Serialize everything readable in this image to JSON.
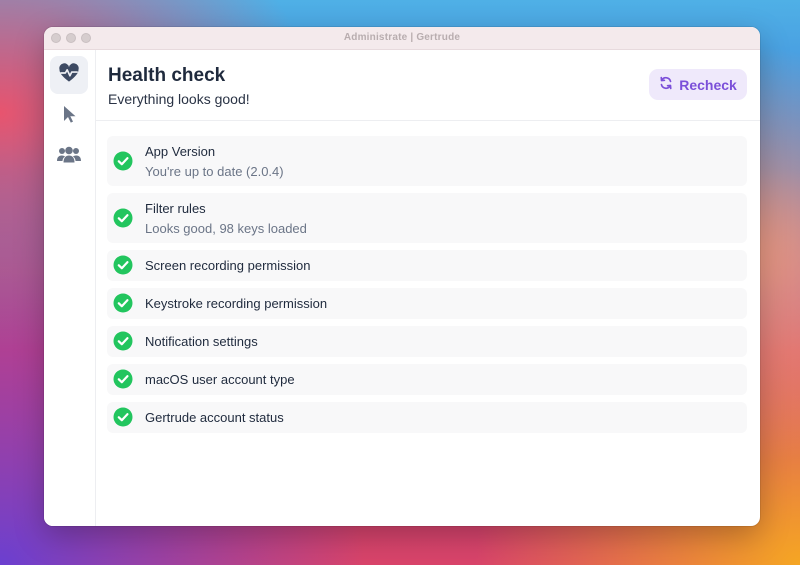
{
  "window": {
    "title": "Administrate  |  Gertrude"
  },
  "sidebar": {
    "items": [
      {
        "name": "health-check",
        "icon": "heart-pulse-icon",
        "active": true
      },
      {
        "name": "actions",
        "icon": "cursor-arrow-icon",
        "active": false
      },
      {
        "name": "users",
        "icon": "users-group-icon",
        "active": false
      }
    ]
  },
  "header": {
    "title": "Health check",
    "subtitle": "Everything looks good!",
    "recheck_label": "Recheck",
    "recheck_icon": "refresh-icon"
  },
  "checks": [
    {
      "label": "App Version",
      "detail": "You're up to date (2.0.4)",
      "status": "ok"
    },
    {
      "label": "Filter rules",
      "detail": "Looks good, 98 keys loaded",
      "status": "ok"
    },
    {
      "label": "Screen recording permission",
      "status": "ok"
    },
    {
      "label": "Keystroke recording permission",
      "status": "ok"
    },
    {
      "label": "Notification settings",
      "status": "ok"
    },
    {
      "label": "macOS user account type",
      "status": "ok"
    },
    {
      "label": "Gertrude account status",
      "status": "ok"
    }
  ],
  "colors": {
    "accent": "#7b4fd9",
    "accent_bg": "#efe9fb",
    "success": "#22c55e",
    "sidebar_icon": "#6b7587"
  }
}
